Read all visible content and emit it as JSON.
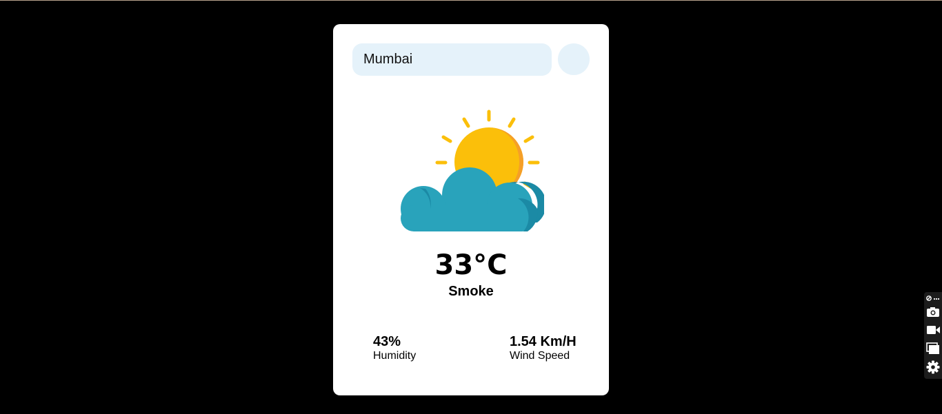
{
  "search": {
    "value": "Mumbai",
    "button_icon": "search-icon"
  },
  "weather": {
    "icon": "partly-cloudy-icon",
    "temperature": "33°C",
    "condition": "Smoke"
  },
  "stats": {
    "humidity": {
      "value": "43%",
      "label": "Humidity"
    },
    "wind": {
      "value": "1.54 Km/H",
      "label": "Wind Speed"
    }
  },
  "toolbar": {
    "icons": [
      "link-icon",
      "more-icon",
      "camera-icon",
      "video-icon",
      "windows-icon",
      "gear-icon"
    ]
  },
  "colors": {
    "background": "#000000",
    "card": "#ffffff",
    "input_bg": "#e5f2fa",
    "sun": "#fbbf0a",
    "sun_shade": "#f59f27",
    "cloud": "#29a3bb",
    "cloud_shade": "#1b8aa5"
  }
}
